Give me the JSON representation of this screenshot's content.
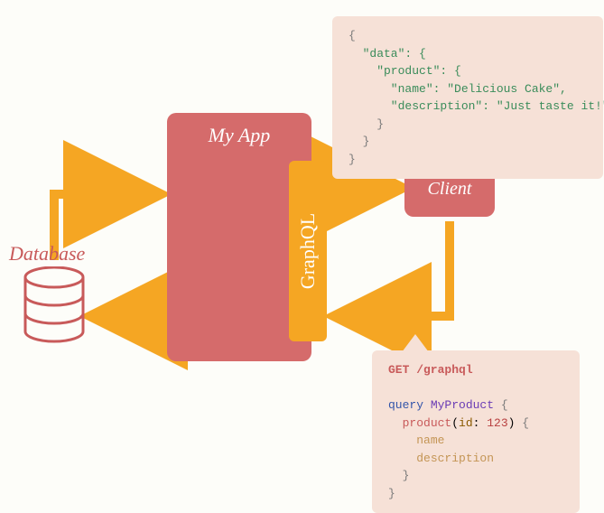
{
  "blocks": {
    "app": "My App",
    "graphql": "GraphQL",
    "client": "Client",
    "database": "Database"
  },
  "response": {
    "l1": "{",
    "l2": "  \"data\": {",
    "l3": "    \"product\": {",
    "l4": "      \"name\": \"Delicious Cake\",",
    "l5": "      \"description\": \"Just taste it!\"",
    "l6": "    }",
    "l7": "  }",
    "l8": "}"
  },
  "request": {
    "method": "GET /graphql",
    "q1": "query MyProduct {",
    "q2": "  product(id: 123) {",
    "q3": "    name",
    "q4": "    description",
    "q5": "  }",
    "q6": "}",
    "kw": "query",
    "opname": "MyProduct",
    "fn": "product",
    "arg": "id",
    "num": "123",
    "f1": "name",
    "f2": "description"
  }
}
